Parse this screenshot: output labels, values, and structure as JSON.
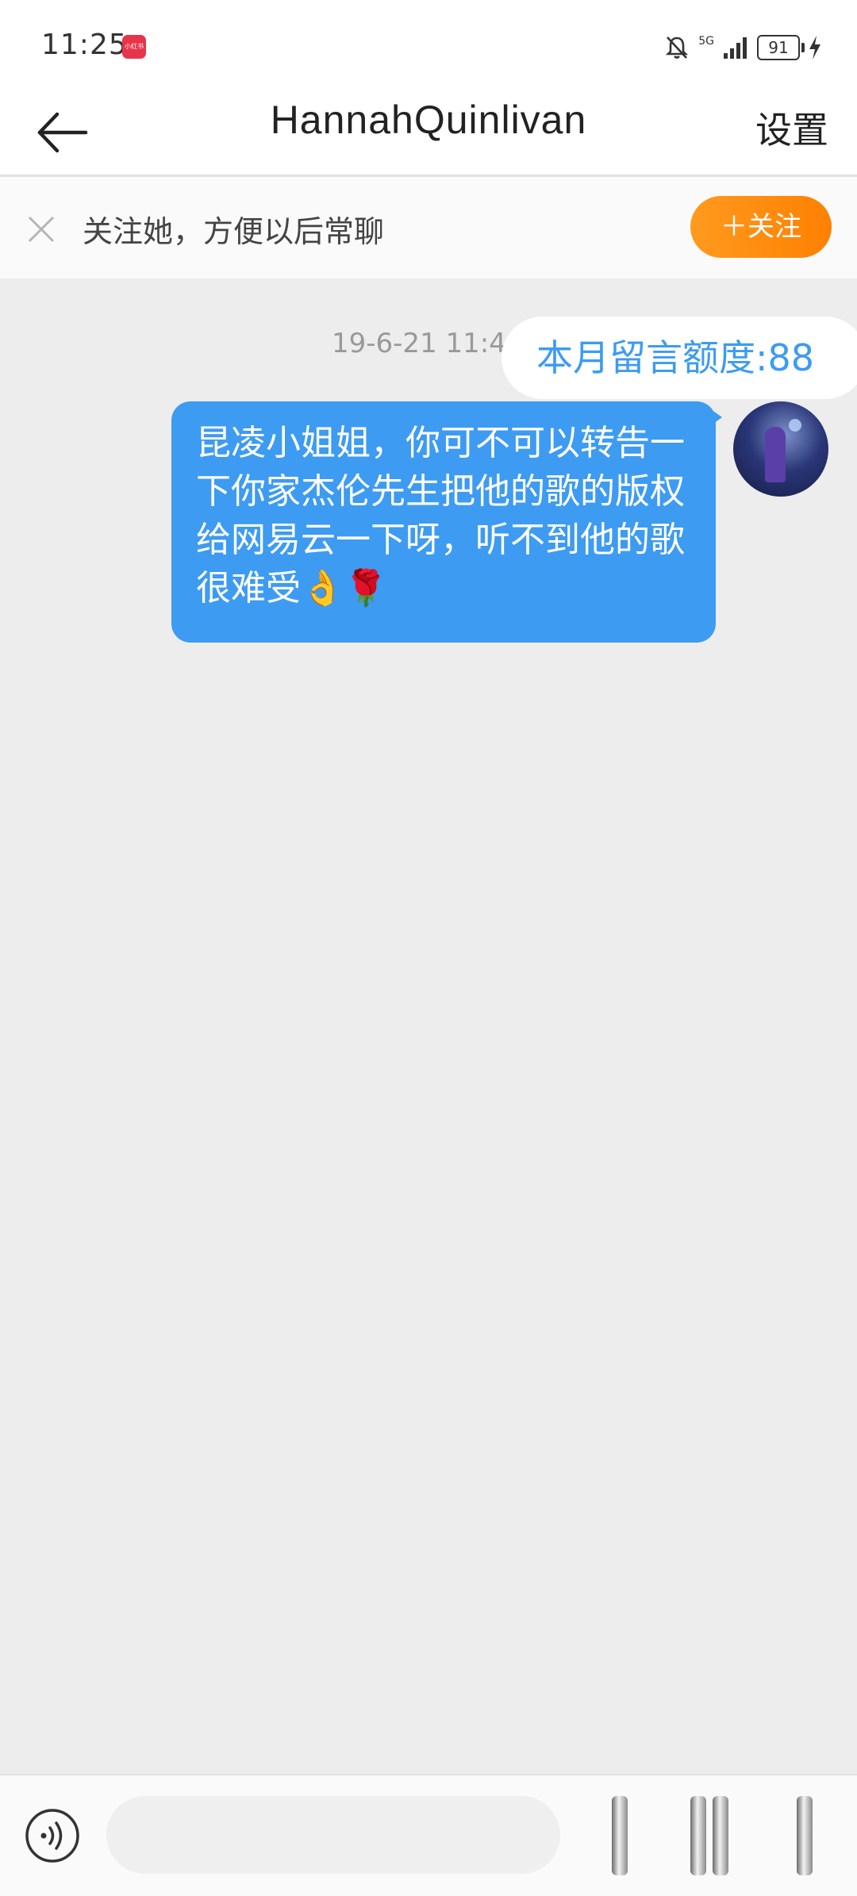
{
  "status_bar": {
    "time": "11:25",
    "app_badge": "小红书",
    "network": "5G",
    "battery": "91",
    "icons": [
      "bell-off-icon",
      "signal-icon",
      "battery-icon",
      "charging-icon"
    ]
  },
  "header": {
    "back_icon": "arrow-left-icon",
    "title": "HannahQuinlivan",
    "settings_label": "设置"
  },
  "follow_banner": {
    "close_icon": "close-icon",
    "text": "关注她，方便以后常聊",
    "follow_button_label": "＋关注",
    "button_color": "#ff8c00"
  },
  "chat": {
    "timestamp": "19-6-21 11:4",
    "quota_tip": "本月留言额度:88",
    "messages": [
      {
        "sender": "self",
        "text": "昆凌小姐姐，你可不可以转告一下你家杰伦先生把他的歌的版权给网易云一下呀，听不到他的歌很难受👌🌹",
        "bubble_color": "#3d9bf2"
      }
    ]
  },
  "input_bar": {
    "voice_icon": "voice-icon",
    "input_value": "",
    "input_placeholder": ""
  }
}
